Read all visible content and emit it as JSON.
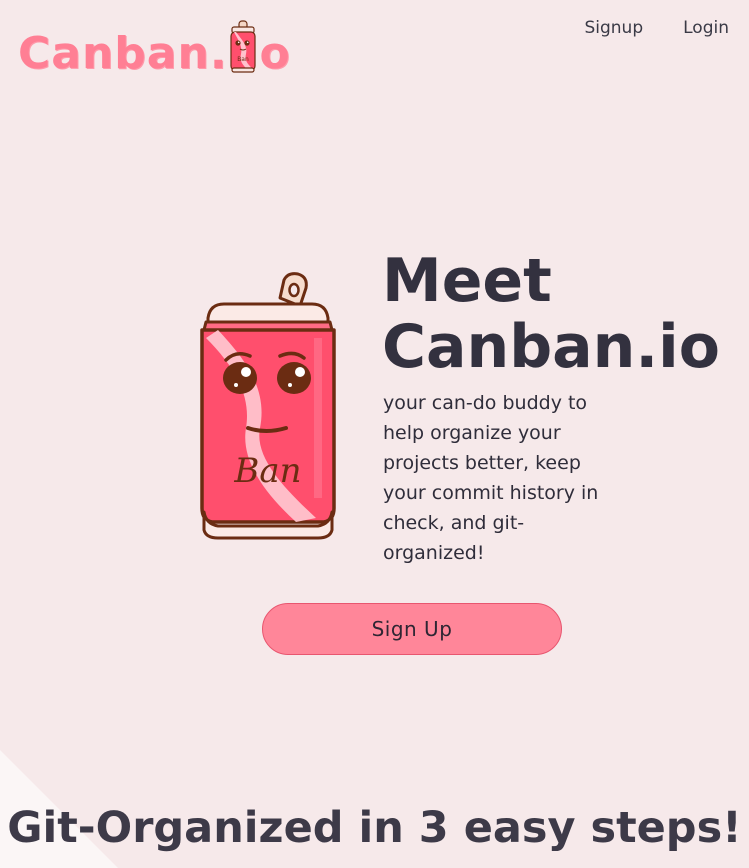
{
  "header": {
    "logo_text_before": "Canban.",
    "logo_text_after": "o",
    "nav": {
      "signup_label": "Signup",
      "login_label": "Login"
    }
  },
  "hero": {
    "title_line1": "Meet",
    "title_line2": "Canban.io",
    "description": "your can-do buddy to help organize your projects better, keep your commit history in check, and git-organized!",
    "can_label": "Ban",
    "signup_button_label": "Sign Up"
  },
  "steps": {
    "heading": "Git-Organized in 3 easy steps!"
  },
  "colors": {
    "background": "#f6e9ea",
    "brand_pink": "#ff7f94",
    "button_pink": "#ff8699",
    "can_red": "#ff4f6d",
    "can_outline": "#6b2c12",
    "text_dark": "#33313f"
  },
  "icons": {
    "logo_mascot": "soda-can-mascot-icon",
    "hero_mascot": "soda-can-mascot-illustration"
  }
}
